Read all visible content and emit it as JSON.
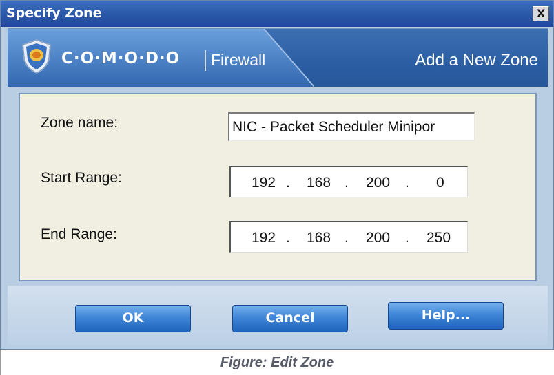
{
  "window": {
    "title": "Specify Zone",
    "close_label": "X"
  },
  "header": {
    "brand": "C·O·M·O·D·O",
    "product": "Firewall",
    "action": "Add a New Zone",
    "logo_icon": "comodo-shield-icon"
  },
  "form": {
    "zone_name_label": "Zone name:",
    "zone_name_value": "NIC - Packet Scheduler  Minipor",
    "start_range_label": "Start Range:",
    "start_range": [
      "192",
      "168",
      "200",
      "0"
    ],
    "end_range_label": "End Range:",
    "end_range": [
      "192",
      "168",
      "200",
      "250"
    ]
  },
  "buttons": {
    "ok": "OK",
    "cancel": "Cancel",
    "help": "Help..."
  },
  "caption": "Figure: Edit Zone",
  "colors": {
    "titlebar": "#2a57a8",
    "brand_band": "#2c5ea3",
    "form_background": "#f1efe2",
    "button_blue": "#3f86d7"
  }
}
